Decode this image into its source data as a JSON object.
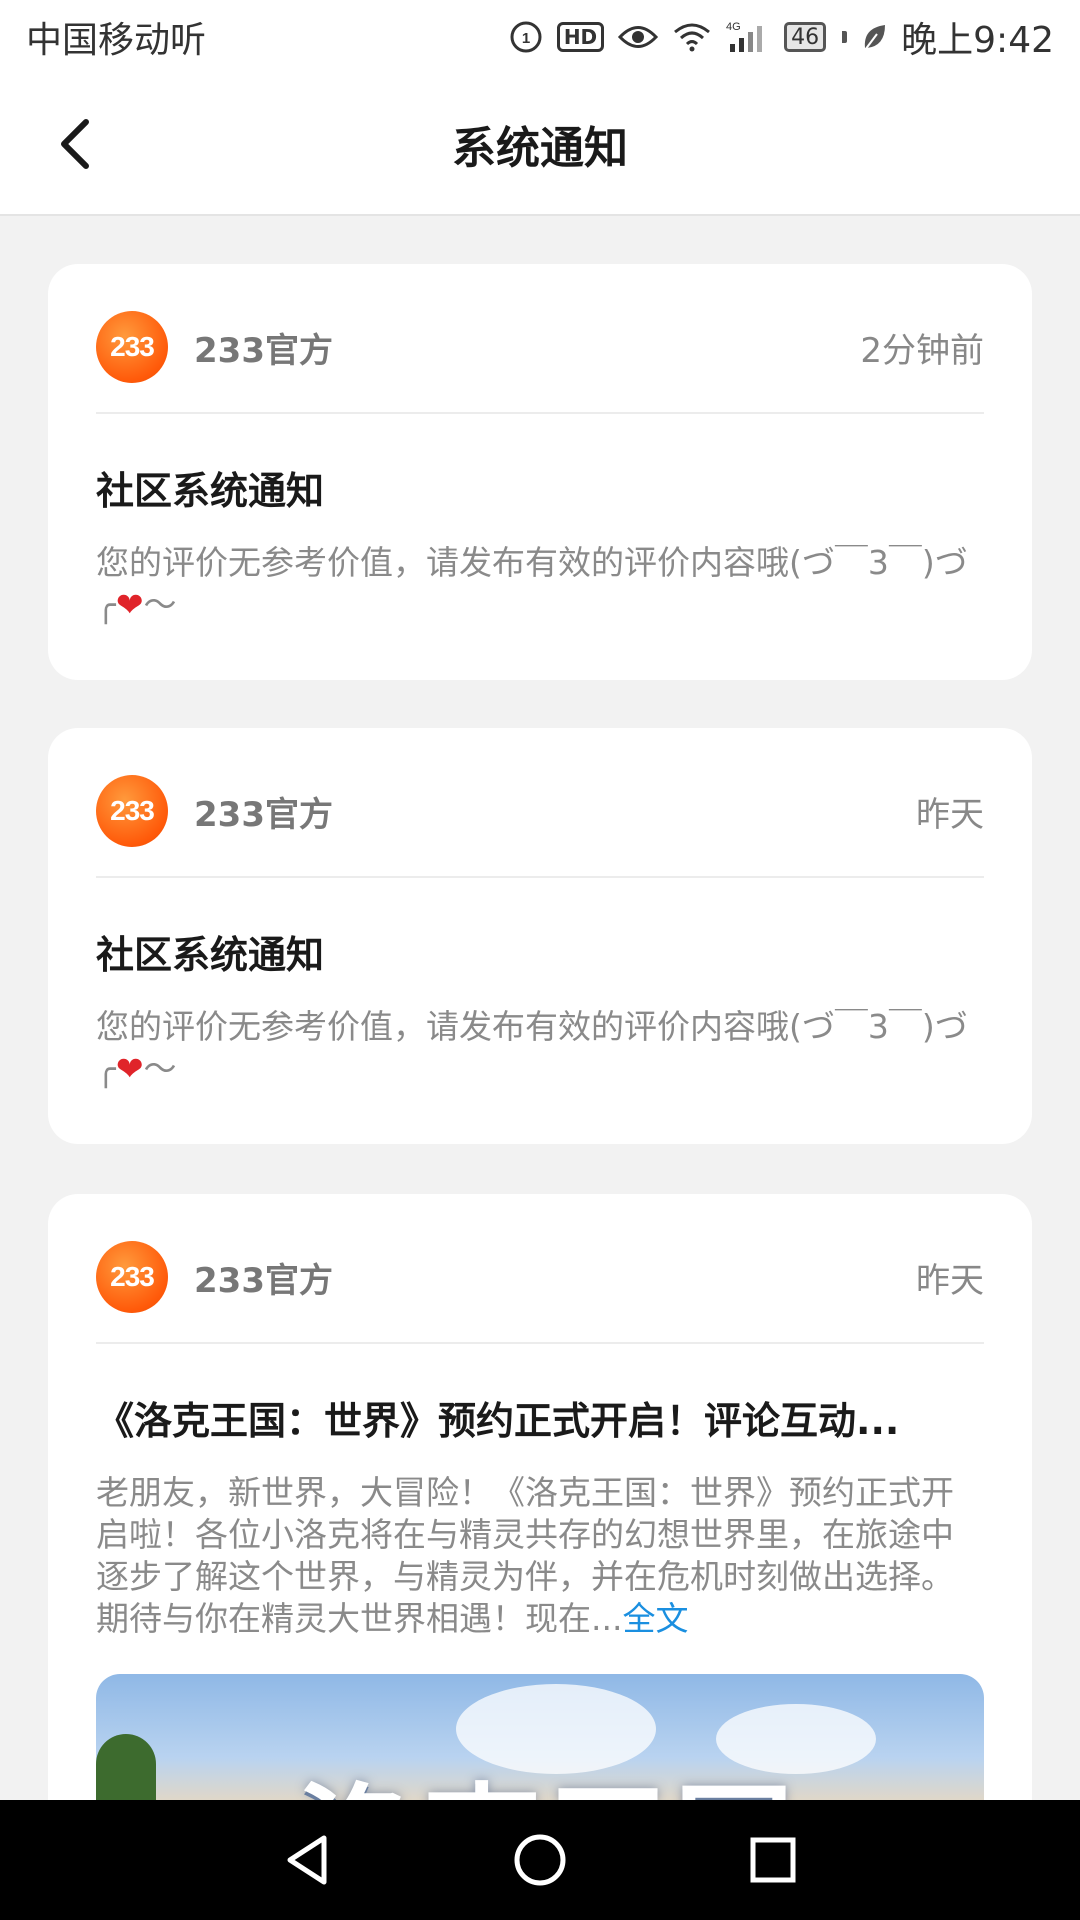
{
  "status_bar": {
    "carrier": "中国移动",
    "carrier_extra": "听",
    "hd_label": "HD",
    "network_label": "4G",
    "battery_level": "46",
    "time": "晚上9:42"
  },
  "header": {
    "title": "系统通知",
    "back_icon": "chevron-left-icon"
  },
  "notifications": [
    {
      "avatar_text": "233",
      "author": "233官方",
      "time": "2分钟前",
      "title": "社区系统通知",
      "body": "您的评价无参考价值，请发布有效的评价内容哦(づ￣3￣)づ╭",
      "heart": "❤",
      "tail": "～"
    },
    {
      "avatar_text": "233",
      "author": "233官方",
      "time": "昨天",
      "title": "社区系统通知",
      "body": "您的评价无参考价值，请发布有效的评价内容哦(づ￣3￣)づ╭",
      "heart": "❤",
      "tail": "～"
    },
    {
      "avatar_text": "233",
      "author": "233官方",
      "time": "昨天",
      "title": "《洛克王国：世界》预约正式开启！评论互动...",
      "body": "老朋友，新世界，大冒险！《洛克王国：世界》预约正式开启啦！各位小洛克将在与精灵共存的幻想世界里，在旅途中逐步了解这个世界，与精灵为伴，并在危机时刻做出选择。期待与你在精灵大世界相遇！现在...",
      "more_label": "全文",
      "banner_text": "洛克王国"
    }
  ],
  "nav_bar": {
    "back_icon": "triangle-back-icon",
    "home_icon": "circle-home-icon",
    "recents_icon": "square-recents-icon"
  }
}
